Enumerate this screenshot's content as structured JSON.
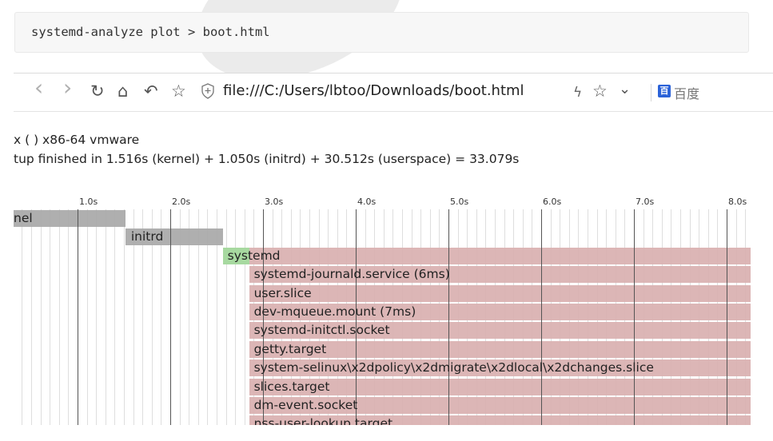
{
  "command": "systemd-analyze plot > boot.html",
  "browser": {
    "back_icon": "‹",
    "forward_icon": "›",
    "reload_icon": "↻",
    "home_icon": "⌂",
    "undo_icon": "↶",
    "bookmark_icon": "☆",
    "url": "file:///C:/Users/lbtoo/Downloads/boot.html",
    "lightning_icon": "ϟ",
    "star_icon": "☆",
    "dropdown_icon": "⌄",
    "baidu_icon": "百",
    "search_engine": "百度"
  },
  "info": {
    "line1": "x ( ) x86-64 vmware",
    "line2": "tup finished in 1.516s (kernel) + 1.050s (initrd) + 30.512s (userspace) = 33.079s"
  },
  "chart_data": {
    "type": "timeline",
    "ticks": [
      "1.0s",
      "2.0s",
      "3.0s",
      "4.0s",
      "5.0s",
      "6.0s",
      "7.0s",
      "8.0s"
    ],
    "units": [
      {
        "label": "nel",
        "start": 0.0,
        "end": 1.516,
        "color": "#a8a8a8"
      },
      {
        "label": "initrd",
        "start": 1.516,
        "end": 2.566,
        "color": "#a8a8a8"
      },
      {
        "label": "systemd",
        "start": 2.566,
        "end": 33.079,
        "color": "#d9b0b0"
      },
      {
        "label": "systemd-journald.service (6ms)",
        "start": 2.85,
        "end": 33.079,
        "color": "#d9b0b0"
      },
      {
        "label": "user.slice",
        "start": 2.85,
        "end": 33.079,
        "color": "#d9b0b0"
      },
      {
        "label": "dev-mqueue.mount (7ms)",
        "start": 2.85,
        "end": 33.079,
        "color": "#d9b0b0"
      },
      {
        "label": "systemd-initctl.socket",
        "start": 2.85,
        "end": 33.079,
        "color": "#d9b0b0"
      },
      {
        "label": "getty.target",
        "start": 2.85,
        "end": 33.079,
        "color": "#d9b0b0"
      },
      {
        "label": "system-selinux\\x2dpolicy\\x2dmigrate\\x2dlocal\\x2dchanges.slice",
        "start": 2.85,
        "end": 33.079,
        "color": "#d9b0b0"
      },
      {
        "label": "slices.target",
        "start": 2.85,
        "end": 33.079,
        "color": "#d9b0b0"
      },
      {
        "label": "dm-event.socket",
        "start": 2.85,
        "end": 33.079,
        "color": "#d9b0b0"
      },
      {
        "label": "nss-user-lookup.target",
        "start": 2.85,
        "end": 33.079,
        "color": "#d9b0b0"
      }
    ]
  }
}
